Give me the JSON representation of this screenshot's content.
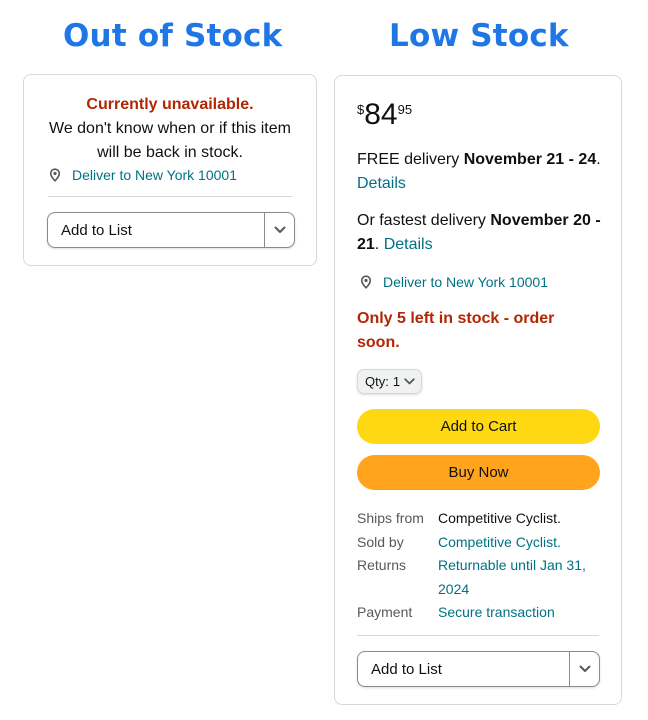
{
  "headings": {
    "out_of_stock": "Out of Stock",
    "low_stock": "Low Stock"
  },
  "colors": {
    "heading": "#1f77e6",
    "alert_red": "#b12704",
    "link_teal": "#007185",
    "cart_yellow": "#ffd814",
    "buy_orange": "#ffa41c"
  },
  "out_of_stock_card": {
    "title": "Currently unavailable.",
    "message": "We don't know when or if this item will be back in stock.",
    "deliver_to": "Deliver to New York 10001",
    "list_button": "Add to List"
  },
  "low_stock_card": {
    "price": {
      "symbol": "$",
      "whole": "84",
      "fraction": "95"
    },
    "free_delivery": {
      "prefix": "FREE delivery ",
      "dates": "November 21 - 24",
      "suffix": ". ",
      "link": "Details"
    },
    "fastest_delivery": {
      "prefix": "Or fastest delivery ",
      "dates": "November 20 - 21",
      "suffix": ". ",
      "link": "Details"
    },
    "deliver_to": "Deliver to New York 10001",
    "stock_message": "Only 5 left in stock - order soon.",
    "quantity": {
      "label": "Qty:",
      "value": "1"
    },
    "add_to_cart": "Add to Cart",
    "buy_now": "Buy Now",
    "info": {
      "ships_from": {
        "key": "Ships from",
        "value": "Competitive Cyclist."
      },
      "sold_by": {
        "key": "Sold by",
        "value": "Competitive Cyclist."
      },
      "returns": {
        "key": "Returns",
        "value": "Returnable until Jan 31, 2024"
      },
      "payment": {
        "key": "Payment",
        "value": "Secure transaction"
      }
    },
    "list_button": "Add to List"
  },
  "icons": {
    "location": "location-pin-icon",
    "dropdown": "chevron-down-icon"
  }
}
